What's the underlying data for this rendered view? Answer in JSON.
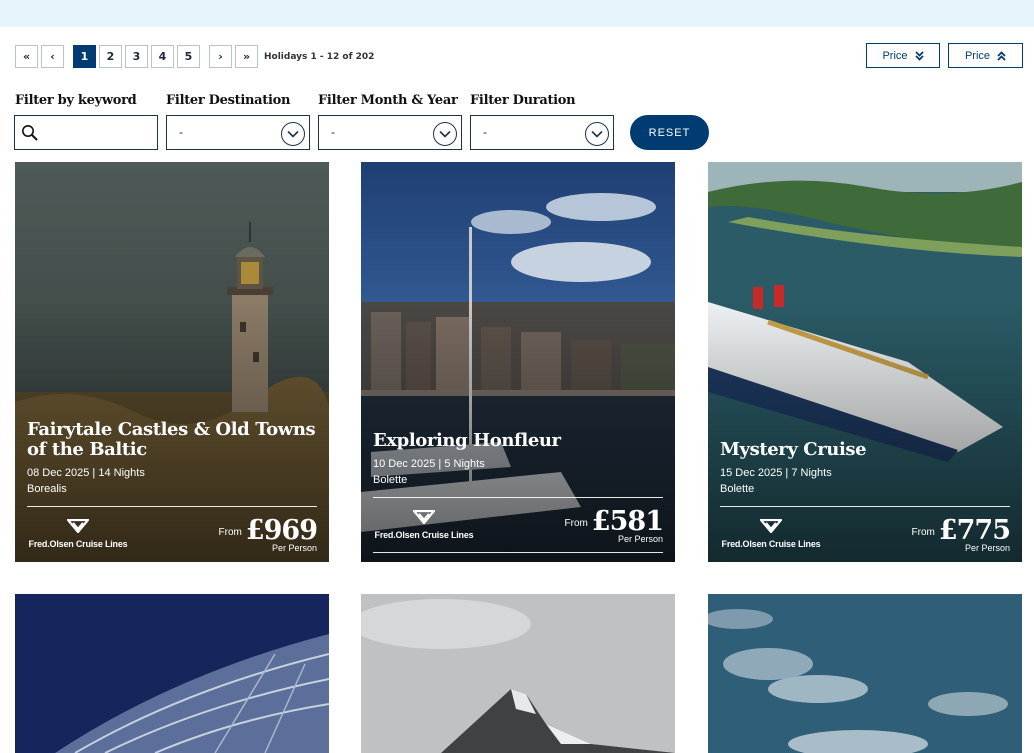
{
  "pagination": {
    "first": "«",
    "prev": "‹",
    "pages": [
      "1",
      "2",
      "3",
      "4",
      "5"
    ],
    "next": "›",
    "last": "»",
    "current": "1",
    "info": "Holidays 1 - 12 of 202"
  },
  "sort": {
    "price_desc": "Price",
    "price_asc": "Price"
  },
  "filters": {
    "keyword_label": "Filter by keyword",
    "keyword_value": "",
    "destination_label": "Filter Destination",
    "destination_value": "-",
    "month_label": "Filter Month & Year",
    "month_value": "-",
    "duration_label": "Filter Duration",
    "duration_value": "-",
    "reset": "RESET"
  },
  "cards": [
    {
      "title": "Fairytale Castles & Old Towns of the Baltic",
      "date": "08 Dec 2025 | 14 Nights",
      "ship": "Borealis",
      "brand": "Fred.Olsen Cruise Lines",
      "from": "From",
      "price": "£969",
      "per": "Per Person"
    },
    {
      "title": "Exploring Honfleur",
      "date": "10 Dec 2025 | 5 Nights",
      "ship": "Bolette",
      "brand": "Fred.Olsen Cruise Lines",
      "from": "From",
      "price": "£581",
      "per": "Per Person"
    },
    {
      "title": "Mystery Cruise",
      "date": "15 Dec 2025 | 7 Nights",
      "ship": "Bolette",
      "brand": "Fred.Olsen Cruise Lines",
      "from": "From",
      "price": "£775",
      "per": "Per Person"
    }
  ],
  "colors": {
    "primary": "#003c71",
    "topbar": "#e8f4fc"
  }
}
